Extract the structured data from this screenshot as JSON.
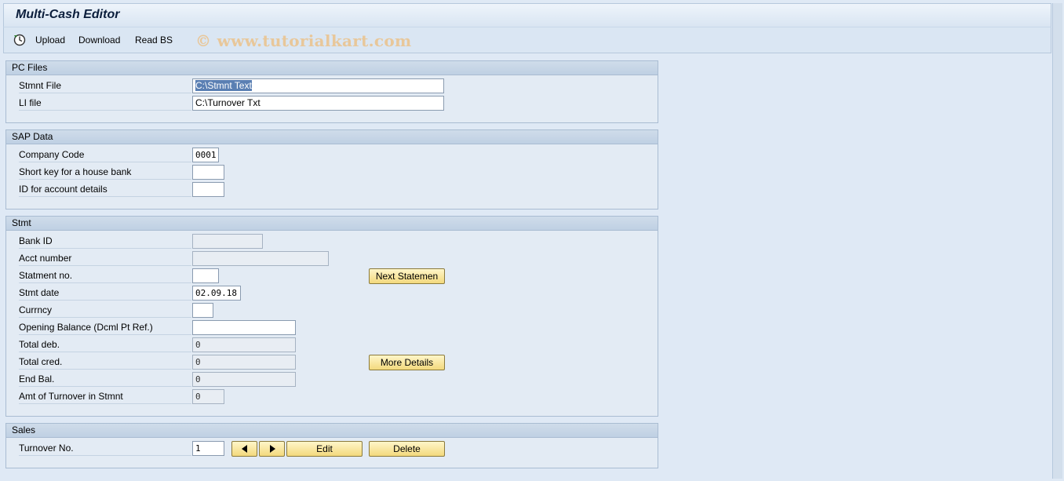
{
  "window": {
    "title": "Multi-Cash Editor"
  },
  "toolbar": {
    "execute_icon": "execute-clock-icon",
    "upload_label": "Upload",
    "download_label": "Download",
    "read_bs_label": "Read BS",
    "watermark": "© www.tutorialkart.com"
  },
  "pc_files": {
    "heading": "PC Files",
    "stmnt_file_label": "Stmnt File",
    "stmnt_file_value": "C:\\Stmnt Text",
    "li_file_label": "LI file",
    "li_file_value": "C:\\Turnover Txt"
  },
  "sap_data": {
    "heading": "SAP Data",
    "company_code_label": "Company Code",
    "company_code_value": "0001",
    "house_bank_label": "Short key for a house bank",
    "house_bank_value": "",
    "account_id_label": "ID for account details",
    "account_id_value": ""
  },
  "stmt": {
    "heading": "Stmt",
    "bank_id_label": "Bank ID",
    "bank_id_value": "",
    "acct_number_label": "Acct number",
    "acct_number_value": "",
    "statement_no_label": "Statment no.",
    "statement_no_value": "",
    "next_statement_label": "Next Statemen",
    "stmt_date_label": "Stmt date",
    "stmt_date_value": "02.09.18",
    "currency_label": "Currncy",
    "currency_value": "",
    "opening_balance_label": "Opening Balance (Dcml Pt Ref.)",
    "opening_balance_value": "",
    "total_deb_label": "Total deb.",
    "total_deb_value": "0",
    "total_cred_label": "Total cred.",
    "total_cred_value": "0",
    "more_details_label": "More Details",
    "end_bal_label": "End Bal.",
    "end_bal_value": "0",
    "amt_turnover_label": "Amt of Turnover in Stmnt",
    "amt_turnover_value": "0"
  },
  "sales": {
    "heading": "Sales",
    "turnover_no_label": "Turnover No.",
    "turnover_no_value": "1",
    "prev_icon": "triangle-left-icon",
    "next_icon": "triangle-right-icon",
    "edit_label": "Edit",
    "delete_label": "Delete"
  }
}
